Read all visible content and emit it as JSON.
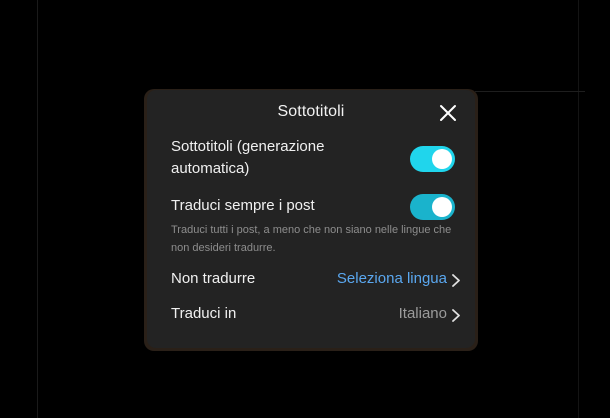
{
  "dialog": {
    "title": "Sottotitoli",
    "close_icon": "close-icon"
  },
  "settings": {
    "auto_captions": {
      "label": "Sottotitoli (generazione automatica)",
      "enabled": true
    },
    "always_translate": {
      "label": "Traduci sempre i post",
      "description": "Traduci tutti i post, a meno che non siano nelle lingue che non desideri tradurre.",
      "enabled": true
    },
    "do_not_translate": {
      "label": "Non tradurre",
      "value": "Seleziona lingua"
    },
    "translate_to": {
      "label": "Traduci in",
      "value": "Italiano"
    }
  },
  "colors": {
    "background": "#000000",
    "panel": "#232323",
    "toggle_on": "#20d5ec",
    "link_blue": "#5aa7ef",
    "muted_text": "#8d8d8d"
  }
}
